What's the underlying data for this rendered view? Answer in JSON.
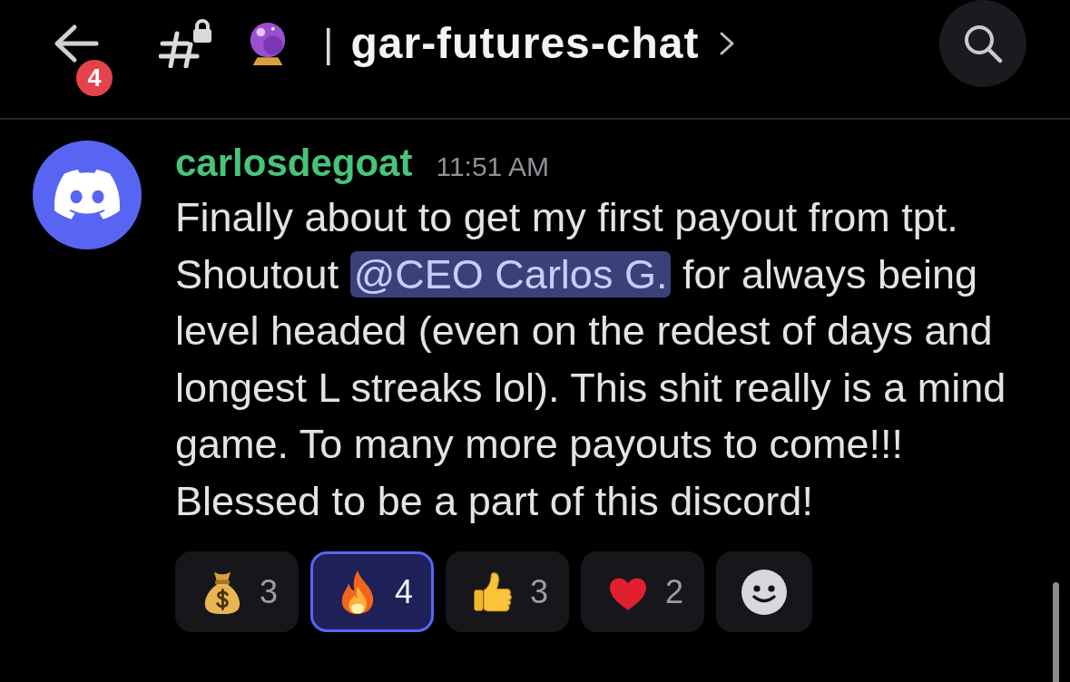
{
  "header": {
    "badge": "4",
    "separator": "|",
    "channel": "gar-futures-chat"
  },
  "message": {
    "author": "carlosdegoat",
    "time": "11:51 AM",
    "content": [
      {
        "kind": "text",
        "text": "Finally about to get my first payout from tpt. Shoutout "
      },
      {
        "kind": "mention",
        "text": "@CEO Carlos G."
      },
      {
        "kind": "text",
        "text": " for always being level headed (even on the redest of days and longest L streaks lol). This shit really is a mind game. To many more payouts to come!!! Blessed to be a part of this discord!"
      }
    ],
    "reactions": [
      {
        "kind": "money-bag",
        "count": "3",
        "selected": false
      },
      {
        "kind": "fire",
        "count": "4",
        "selected": true
      },
      {
        "kind": "thumbs-up",
        "count": "3",
        "selected": false
      },
      {
        "kind": "heart",
        "count": "2",
        "selected": false
      }
    ]
  }
}
